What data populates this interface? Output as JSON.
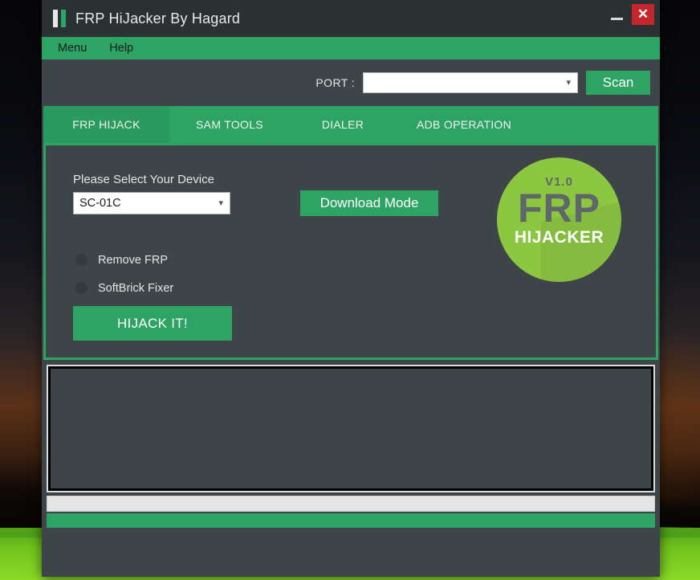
{
  "window": {
    "title": "FRP HiJacker By Hagard",
    "logo_icon": "two-bars-icon",
    "minimize_label": "—",
    "close_label": "✕",
    "accent_green": "#2da364",
    "panel_dark": "#3d4548",
    "titlebar_dark": "#2b3033",
    "close_red": "#c5262b"
  },
  "menubar": {
    "items": [
      {
        "label": "Menu"
      },
      {
        "label": "Help"
      }
    ]
  },
  "toolbar": {
    "port_label": "PORT :",
    "port_value": "",
    "port_placeholder": "",
    "port_chevron_icon": "chevron-down-icon",
    "scan_label": "Scan"
  },
  "tabs": [
    {
      "label": "FRP HIJACK",
      "active": true
    },
    {
      "label": "SAM TOOLS",
      "active": false
    },
    {
      "label": "DIALER",
      "active": false
    },
    {
      "label": "ADB OPERATION",
      "active": false
    }
  ],
  "main": {
    "device_label": "Please Select Your Device",
    "device_value": "SC-01C",
    "device_chevron_icon": "chevron-down-icon",
    "download_mode_label": "Download Mode",
    "options": [
      {
        "label": "Remove FRP",
        "selected": false
      },
      {
        "label": "SoftBrick Fixer",
        "selected": false
      }
    ],
    "hijack_label": "HIJACK IT!",
    "logo": {
      "version": "V1.0",
      "brand": "FRP",
      "subtitle": "HIJACKER",
      "circle_color": "#8cc741",
      "text_color": "#5f6769"
    }
  },
  "log": {
    "content": ""
  },
  "progress": {
    "value": 0,
    "text": ""
  },
  "status": {
    "text": ""
  }
}
